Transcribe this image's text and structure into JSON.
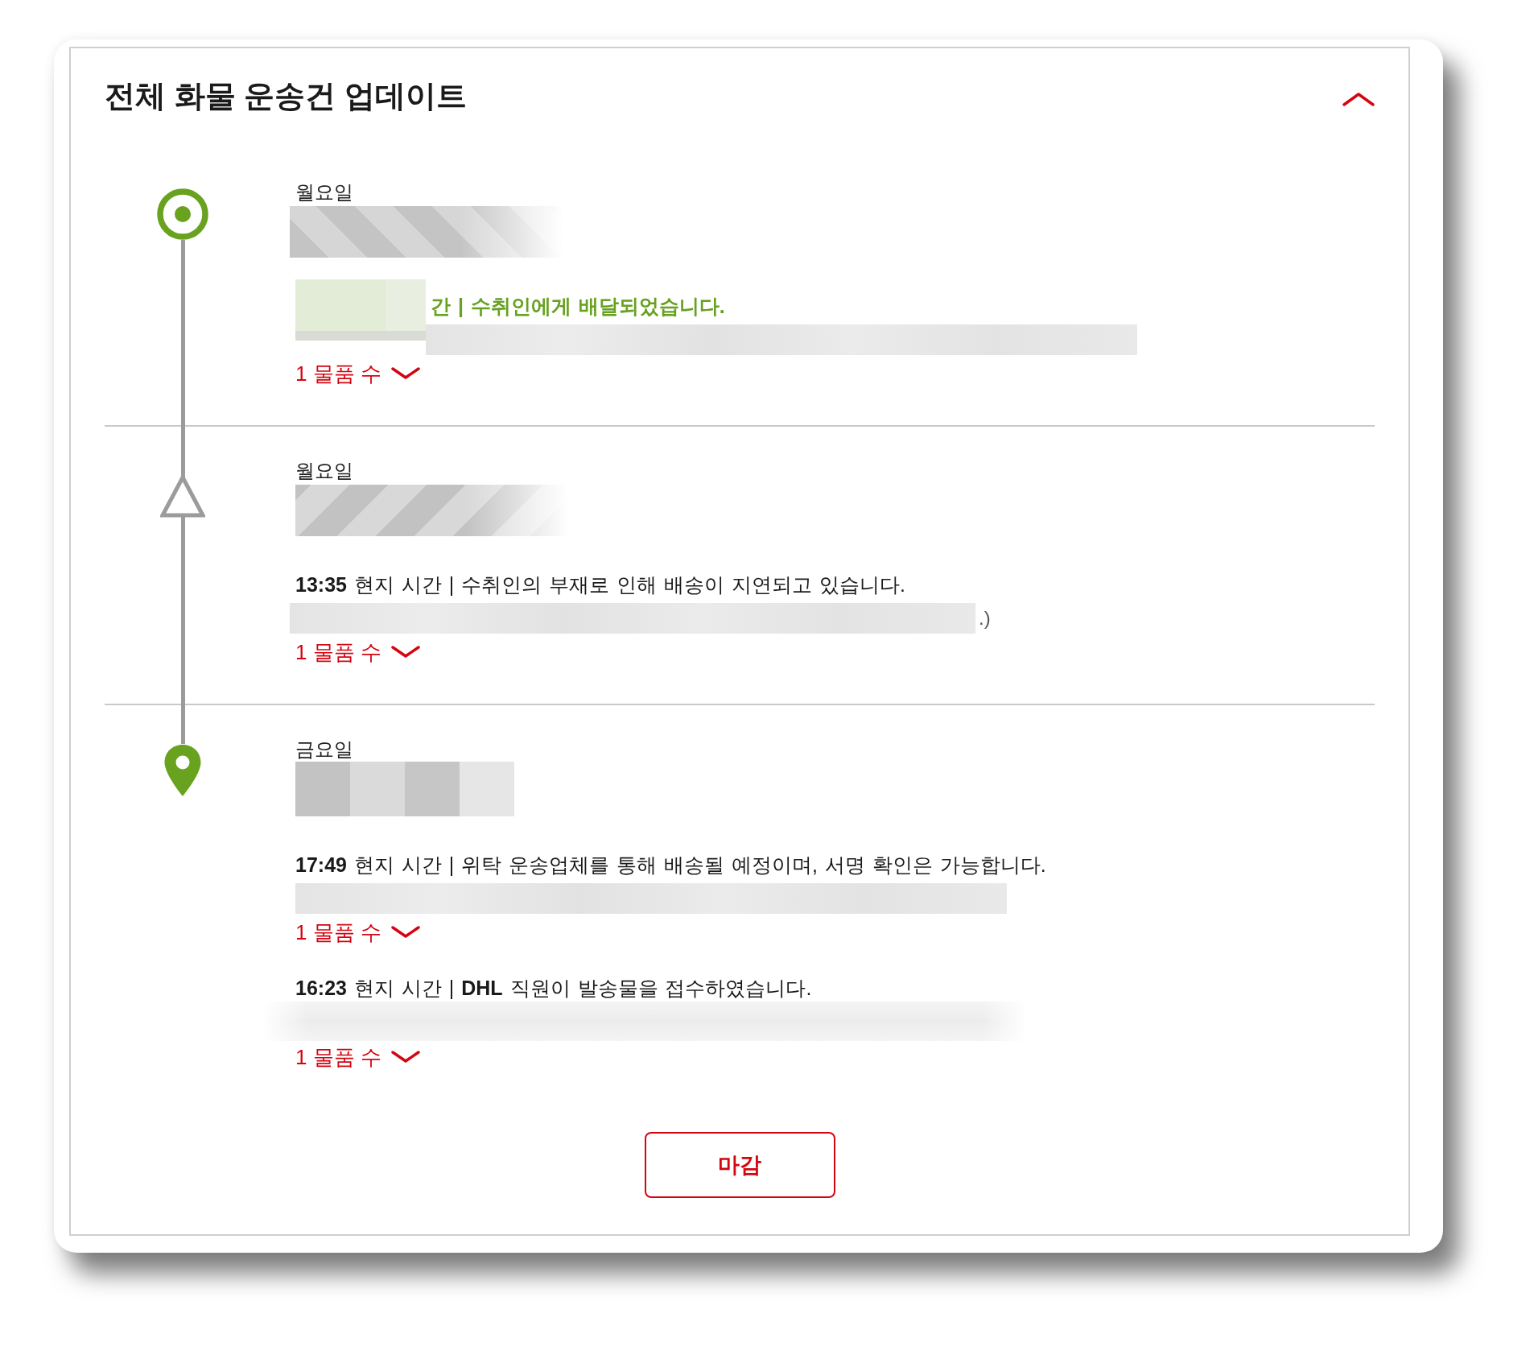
{
  "panel": {
    "title": "전체 화물 운송건 업데이트",
    "expanded": true
  },
  "days": [
    {
      "day": "월요일",
      "kind": "target",
      "events": [
        {
          "kind": "masked",
          "status": "간 | 수취인에게 배달되었습니다.",
          "highlighted": true,
          "items_link": {
            "label": "1 물품 수",
            "expanded": false
          }
        }
      ]
    },
    {
      "day": "월요일",
      "kind": "triangle",
      "events": [
        {
          "kind": "plain",
          "status": "**13:35** 현지 시간 | 수취인의 부재로 인해 배송이 지연되고 있습니다.",
          "highlighted": false,
          "location": ".)",
          "items_link": {
            "label": "1 물품 수",
            "expanded": false
          }
        }
      ]
    },
    {
      "day": "금요일",
      "kind": "pin",
      "events": [
        {
          "kind": "plain",
          "status": "**17:49** 현지 시간 | 위탁 운송업체를 통해 배송될 예정이며, 서명 확인은 가능합니다.",
          "highlighted": false,
          "items_link": {
            "label": "1 물품 수",
            "expanded": false
          }
        },
        {
          "kind": "plain",
          "status": "**16:23** 현지 시간 | **DHL** 직원이 발송물을 접수하였습니다.",
          "highlighted": false,
          "items_link": {
            "label": "1 물품 수",
            "expanded": false
          }
        }
      ]
    }
  ],
  "close_button": "마감"
}
